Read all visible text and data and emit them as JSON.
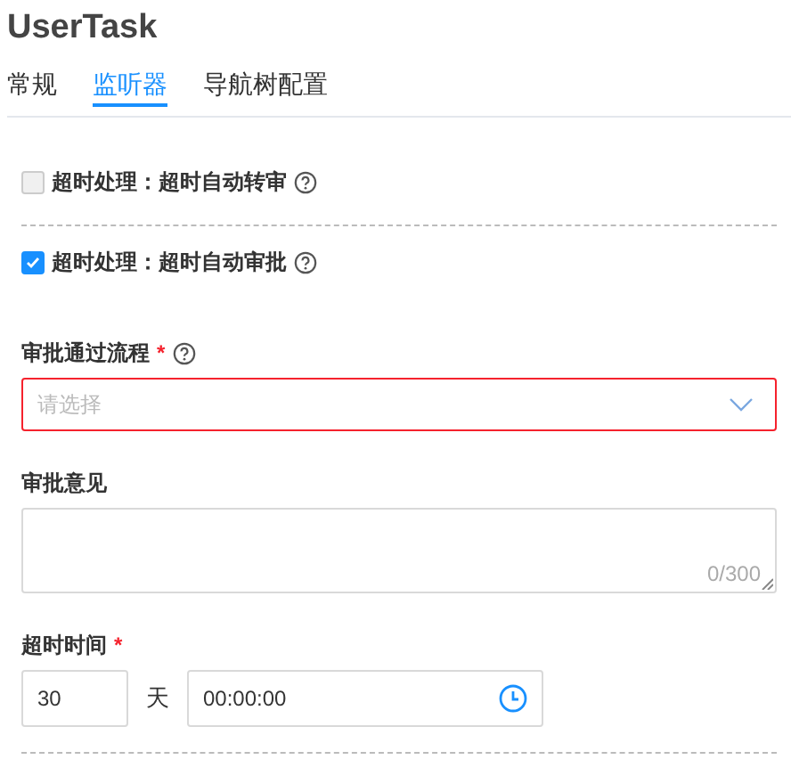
{
  "title": "UserTask",
  "tabs": [
    {
      "label": "常规",
      "selected": false
    },
    {
      "label": "监听器",
      "selected": true
    },
    {
      "label": "导航树配置",
      "selected": false
    }
  ],
  "options": [
    {
      "label": "超时处理：超时自动转审",
      "checked": false
    },
    {
      "label": "超时处理：超时自动审批",
      "checked": true
    }
  ],
  "approval_flow": {
    "label": "审批通过流程",
    "required_mark": "*",
    "placeholder": "请选择",
    "invalid": true
  },
  "comment": {
    "label": "审批意见",
    "counter": "0/300"
  },
  "timeout": {
    "label": "超时时间",
    "required_mark": "*",
    "days": "30",
    "unit": "天",
    "time": "00:00:00"
  }
}
